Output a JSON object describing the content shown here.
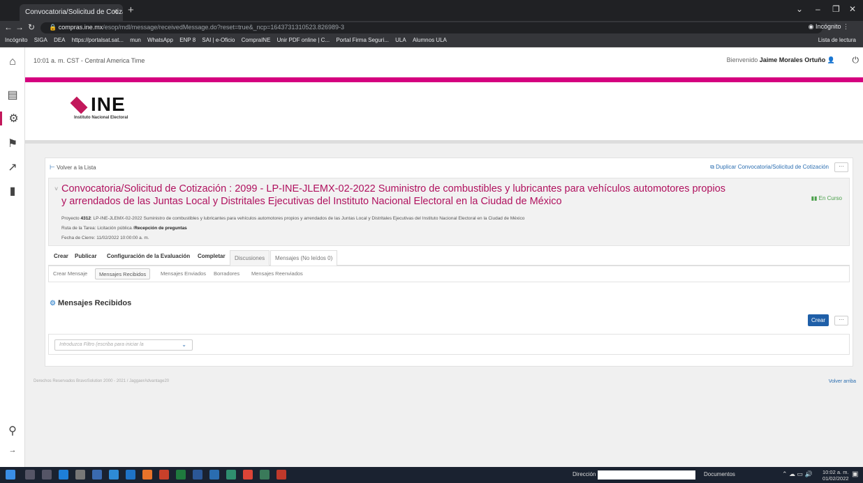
{
  "browser": {
    "tab_title": "Convocatoria/Solicitud de Cotiza",
    "url_host": "compras.ine.mx",
    "url_path": "/esop/mdl/message/receivedMessage.do?reset=true&_ncp=1643731310523.826989-3",
    "profile": "Incógnito",
    "bookmarks": [
      "Incógnito",
      "SIGA",
      "DEA",
      "https://portalsat.sat...",
      "mun",
      "WhatsApp",
      "ENP 8",
      "SAI | e-Oficio",
      "CompraINE",
      "Unir PDF online | C...",
      "Portal Firma Seguri...",
      "ULA",
      "Alumnos ULA"
    ],
    "reading_list": "Lista de lectura"
  },
  "topbar": {
    "time": "10:01 a. m. CST - Central America Time",
    "welcome_prefix": "Bienvenido",
    "user": "Jaime Morales Ortuño"
  },
  "logo": {
    "text": "INE",
    "subtitle": "Instituto Nacional Electoral"
  },
  "card": {
    "back_label": "Volver a la Lista",
    "duplicate_label": "Duplicar Convocatoria/Solicitud de Cotización",
    "more_label": "···",
    "title": "Convocatoria/Solicitud de Cotización : 2099 - LP-INE-JLEMX-02-2022 Suministro de combustibles y lubricantes para vehículos automotores propios y arrendados de las Juntas Local y Distritales Ejecutivas del Instituto Nacional Electoral en la Ciudad de México",
    "status": "En Curso",
    "project_label": "Proyecto",
    "project_id": "4312",
    "project_desc": ": LP-INE-JLEMX-02-2022 Suministro de combustibles y lubricantes para vehículos automotores propios y arrendados de las Juntas Local y Distritales Ejecutivas del Instituto Nacional Electoral en la Ciudad de México",
    "route_label": "Ruta de la Tarea: Licitación pública /",
    "route_value": "Recepción de preguntas",
    "close_date": "Fecha de Cierre: 11/02/2022 10:00:00 a. m."
  },
  "tabs": [
    "Crear",
    "Publicar",
    "Configuración de la Evaluación",
    "Completar",
    "Discusiones",
    "Mensajes (No leídos 0)"
  ],
  "subtabs": [
    "Crear Mensaje",
    "Mensajes Recibidos",
    "Mensajes Enviados",
    "Borradores",
    "Mensajes Reenviados"
  ],
  "section_title": "Mensajes Recibidos",
  "create_button": "Crear",
  "filter_placeholder": "Introduzca Filtro (escriba para iniciar la",
  "footer": {
    "left": "Derechos Reservados BravoSolution 2000 - 2021 / JaggaerAdvantage20",
    "right": "Volver arriba"
  },
  "taskbar": {
    "address_label": "Dirección",
    "docs_label": "Documentos",
    "clock_time": "10:02 a. m.",
    "clock_date": "01/02/2022"
  },
  "colors": {
    "brand_pink": "#d5007f",
    "title_magenta": "#b0115e",
    "primary_blue": "#1f5fa8"
  }
}
